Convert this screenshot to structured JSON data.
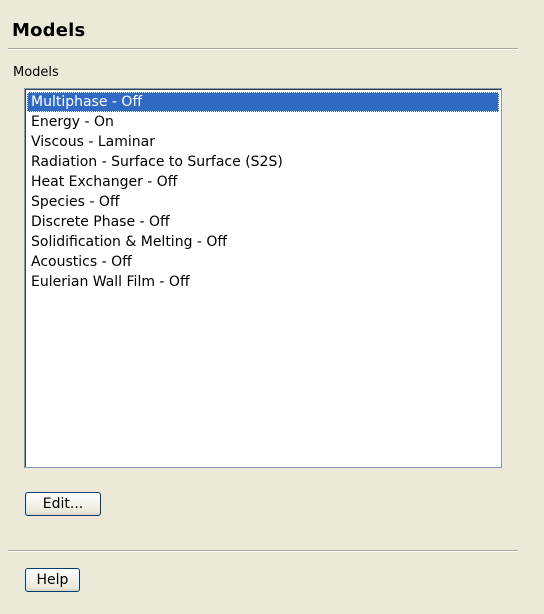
{
  "panel": {
    "title": "Models"
  },
  "models_group": {
    "label": "Models",
    "items": [
      {
        "label": "Multiphase - Off",
        "selected": true
      },
      {
        "label": "Energy - On",
        "selected": false
      },
      {
        "label": "Viscous - Laminar",
        "selected": false
      },
      {
        "label": "Radiation - Surface to Surface (S2S)",
        "selected": false
      },
      {
        "label": "Heat Exchanger - Off",
        "selected": false
      },
      {
        "label": "Species - Off",
        "selected": false
      },
      {
        "label": "Discrete Phase - Off",
        "selected": false
      },
      {
        "label": "Solidification & Melting - Off",
        "selected": false
      },
      {
        "label": "Acoustics - Off",
        "selected": false
      },
      {
        "label": "Eulerian Wall Film - Off",
        "selected": false
      }
    ]
  },
  "buttons": {
    "edit_label": "Edit...",
    "help_label": "Help"
  },
  "colors": {
    "panel_background": "#ece9d8",
    "selection_background": "#316ac5",
    "selection_text": "#ffffff",
    "list_border": "#7f9db9"
  }
}
